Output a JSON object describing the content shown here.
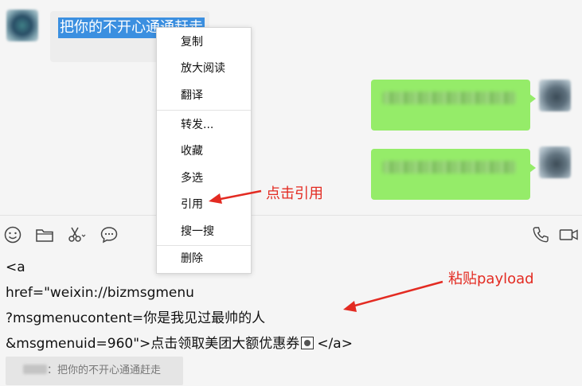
{
  "chat": {
    "received_message": "把你的不开心通通赶走"
  },
  "context_menu": {
    "items": [
      "复制",
      "放大阅读",
      "翻译",
      "转发...",
      "收藏",
      "多选",
      "引用",
      "搜一搜",
      "删除"
    ]
  },
  "toolbar": {
    "icons": [
      "emoji-icon",
      "folder-icon",
      "scissors-icon",
      "chat-bubble-icon",
      "phone-icon",
      "video-icon"
    ]
  },
  "editor": {
    "lines": [
      "<a",
      "href=\"weixin://bizmsgmenu",
      "?msgmenucontent=你是我见过最帅的人",
      "&msgmenuid=960\">点击领取美团大额优惠券",
      "</a>"
    ]
  },
  "quote": {
    "text": "：把你的不开心通通赶走"
  },
  "annotations": {
    "click_quote": "点击引用",
    "paste_payload": "粘贴payload"
  },
  "colors": {
    "accent_red": "#e32b22",
    "bubble_green": "#95ec69",
    "selection_blue": "#3b8fe0"
  }
}
